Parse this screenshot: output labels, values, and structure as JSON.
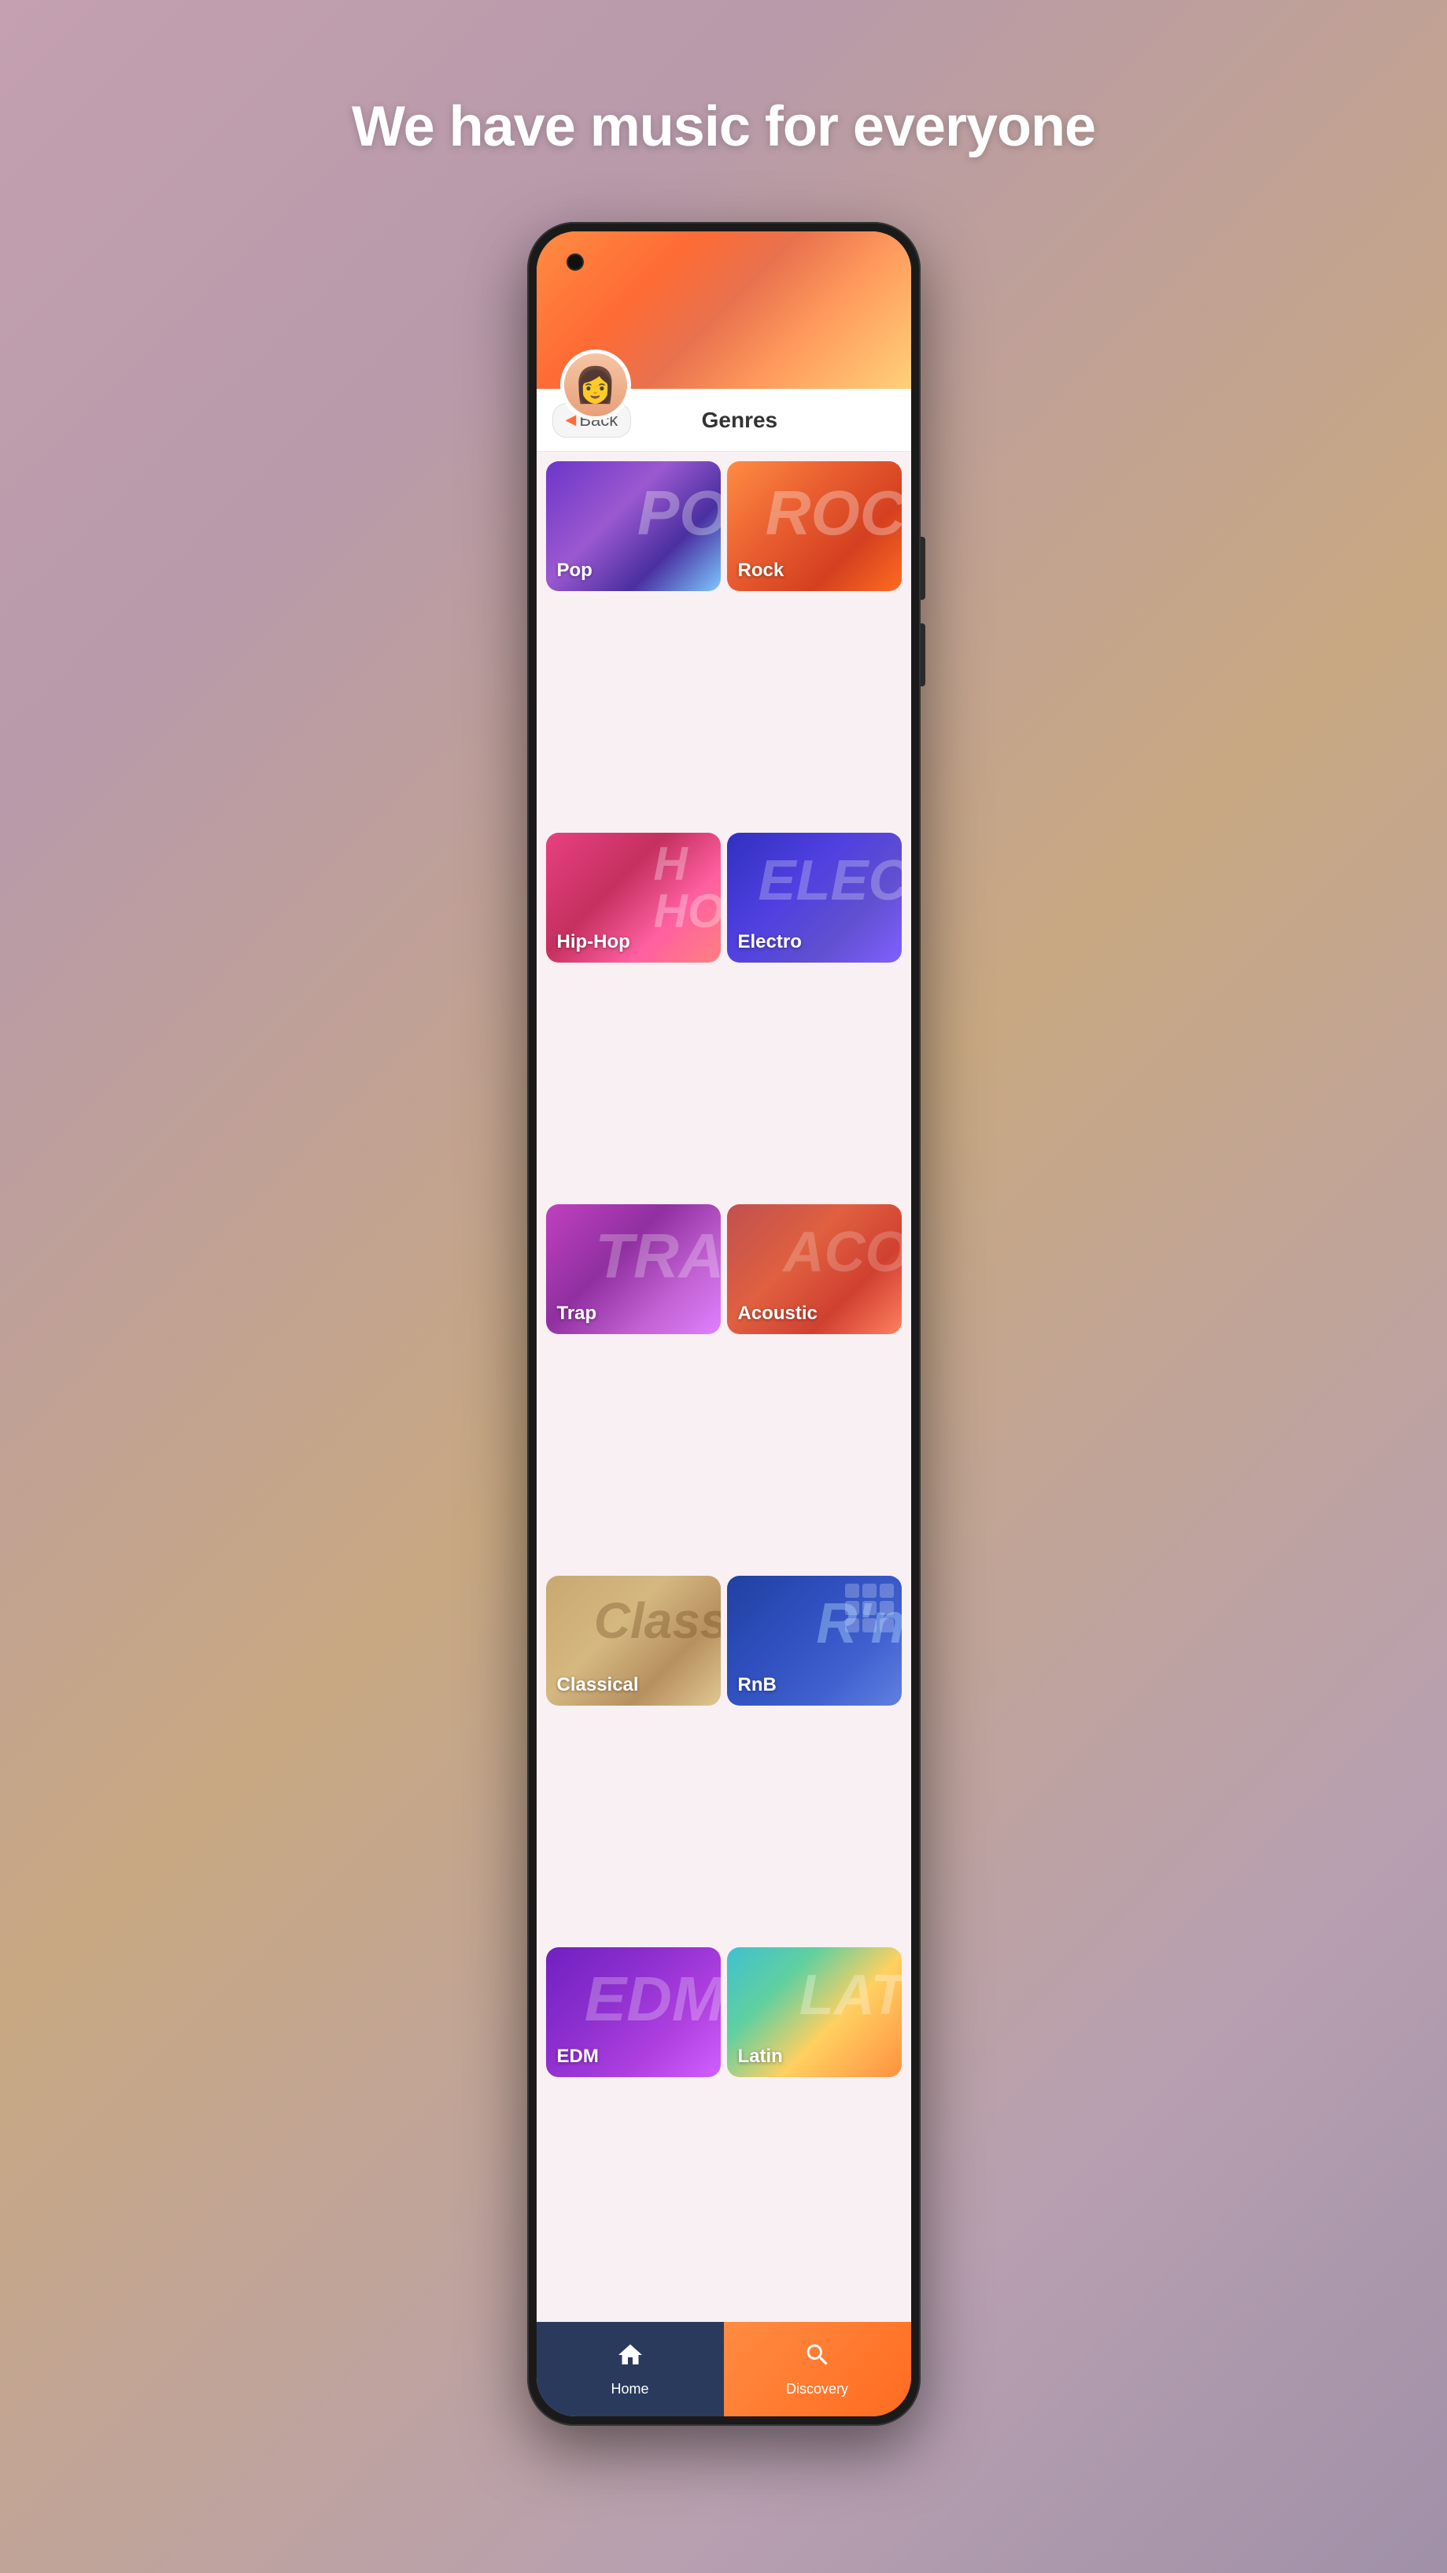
{
  "page": {
    "headline": "We have music for everyone"
  },
  "nav": {
    "back_label": "Back",
    "title": "Genres"
  },
  "genres": [
    {
      "id": "pop",
      "label": "Pop",
      "bg_class": "genre-pop",
      "overlay_text": "POP"
    },
    {
      "id": "rock",
      "label": "Rock",
      "bg_class": "genre-rock",
      "overlay_text": "ROC"
    },
    {
      "id": "hiphop",
      "label": "Hip-Hop",
      "bg_class": "genre-hiphop",
      "overlay_text": "HIP\nHOP"
    },
    {
      "id": "electro",
      "label": "Electro",
      "bg_class": "genre-electro",
      "overlay_text": "ELECT"
    },
    {
      "id": "trap",
      "label": "Trap",
      "bg_class": "genre-trap",
      "overlay_text": "TRA"
    },
    {
      "id": "acoustic",
      "label": "Acoustic",
      "bg_class": "genre-acoustic",
      "overlay_text": "ACO"
    },
    {
      "id": "classical",
      "label": "Classical",
      "bg_class": "genre-classical",
      "overlay_text": "Class"
    },
    {
      "id": "rnb",
      "label": "RnB",
      "bg_class": "genre-rnb",
      "overlay_text": "R'n"
    },
    {
      "id": "edm",
      "label": "EDM",
      "bg_class": "genre-edm",
      "overlay_text": "EDM"
    },
    {
      "id": "latin",
      "label": "Latin",
      "bg_class": "genre-latin",
      "overlay_text": "LAT"
    }
  ],
  "tabs": [
    {
      "id": "home",
      "label": "Home",
      "icon": "🏠",
      "active": false
    },
    {
      "id": "discovery",
      "label": "Discovery",
      "icon": "🔍",
      "active": true
    }
  ]
}
